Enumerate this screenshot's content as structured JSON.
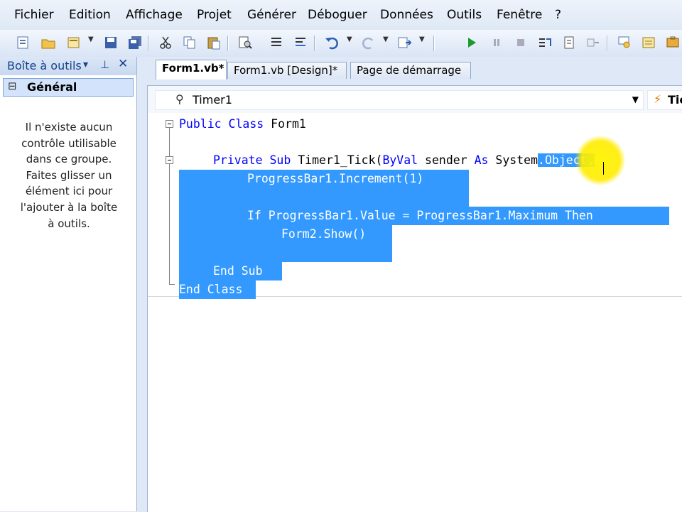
{
  "menu": {
    "items": [
      "Fichier",
      "Edition",
      "Affichage",
      "Projet",
      "Générer",
      "Déboguer",
      "Données",
      "Outils",
      "Fenêtre",
      "?"
    ]
  },
  "toolbox": {
    "title": "Boîte à outils",
    "pin_glyph": "▾ ⊥ ✕",
    "group_expander": "⊟",
    "group_label": "Général",
    "empty_lines": [
      "Il n'existe aucun",
      "contrôle utilisable",
      "dans ce groupe.",
      "Faites glisser un",
      "élément ici pour",
      "l'ajouter à la boîte",
      "à outils."
    ]
  },
  "tabs": [
    {
      "label": "Form1.vb*"
    },
    {
      "label": "Form1.vb [Design]*"
    },
    {
      "label": "Page de démarrage"
    }
  ],
  "navbar": {
    "class_value": "Timer1",
    "method_value": "Tic"
  },
  "code": {
    "line1_kw1": "Public",
    "line1_kw2": "Class",
    "line1_rest": " Form1",
    "line2_kw1": "Private",
    "line2_kw2": "Sub",
    "line2_mid": " Timer1_Tick(",
    "line2_kw3": "ByVal",
    "line2_mid2": " sender ",
    "line2_kw4": "As",
    "line2_mid3": " System",
    "line2_sel": ".Object,",
    "line3": "ProgressBar1.Increment(1)",
    "line4_kw": "If",
    "line4_mid": " ProgressBar1.Value = ProgressBar1.Maximum ",
    "line4_kw2": "Then",
    "line5": "Form2.Show()",
    "line6_kw1": "End",
    "line6_kw2": "Sub",
    "line7_kw1": "End",
    "line7_kw2": "Class"
  },
  "colors": {
    "selection": "#3399ff",
    "keyword": "#0000ff",
    "cursor_highlight": "#ffee00"
  }
}
